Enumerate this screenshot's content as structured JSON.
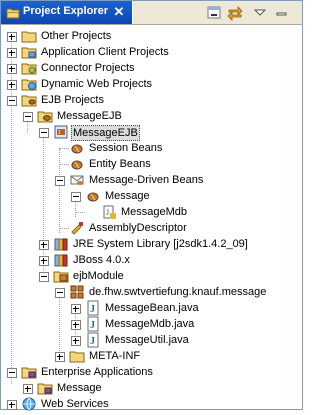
{
  "view": {
    "title": "Project Explorer",
    "close_icon": "close-icon",
    "tools": [
      "minimize-icon",
      "link-with-editor-icon",
      "view-menu-icon"
    ]
  },
  "tree": {
    "other_projects": "Other Projects",
    "app_client_projects": "Application Client Projects",
    "connector_projects": "Connector Projects",
    "dynamic_web_projects": "Dynamic Web Projects",
    "ejb_projects": "EJB Projects",
    "message_ejb": "MessageEJB",
    "message_ejb_descriptor": "MessageEJB",
    "session_beans": "Session Beans",
    "entity_beans": "Entity Beans",
    "message_driven_beans": "Message-Driven Beans",
    "message": "Message",
    "message_mdb": "MessageMdb",
    "assembly_descriptor": "AssemblyDescriptor",
    "jre_library": "JRE System Library [j2sdk1.4.2_09]",
    "jboss": "JBoss 4.0.x",
    "ejb_module": "ejbModule",
    "package": "de.fhw.swtvertiefung.knauf.message",
    "message_bean_java": "MessageBean.java",
    "message_mdb_java": "MessageMdb.java",
    "message_util_java": "MessageUtil.java",
    "meta_inf": "META-INF",
    "enterprise_applications": "Enterprise Applications",
    "ear_message": "Message",
    "web_services": "Web Services"
  }
}
